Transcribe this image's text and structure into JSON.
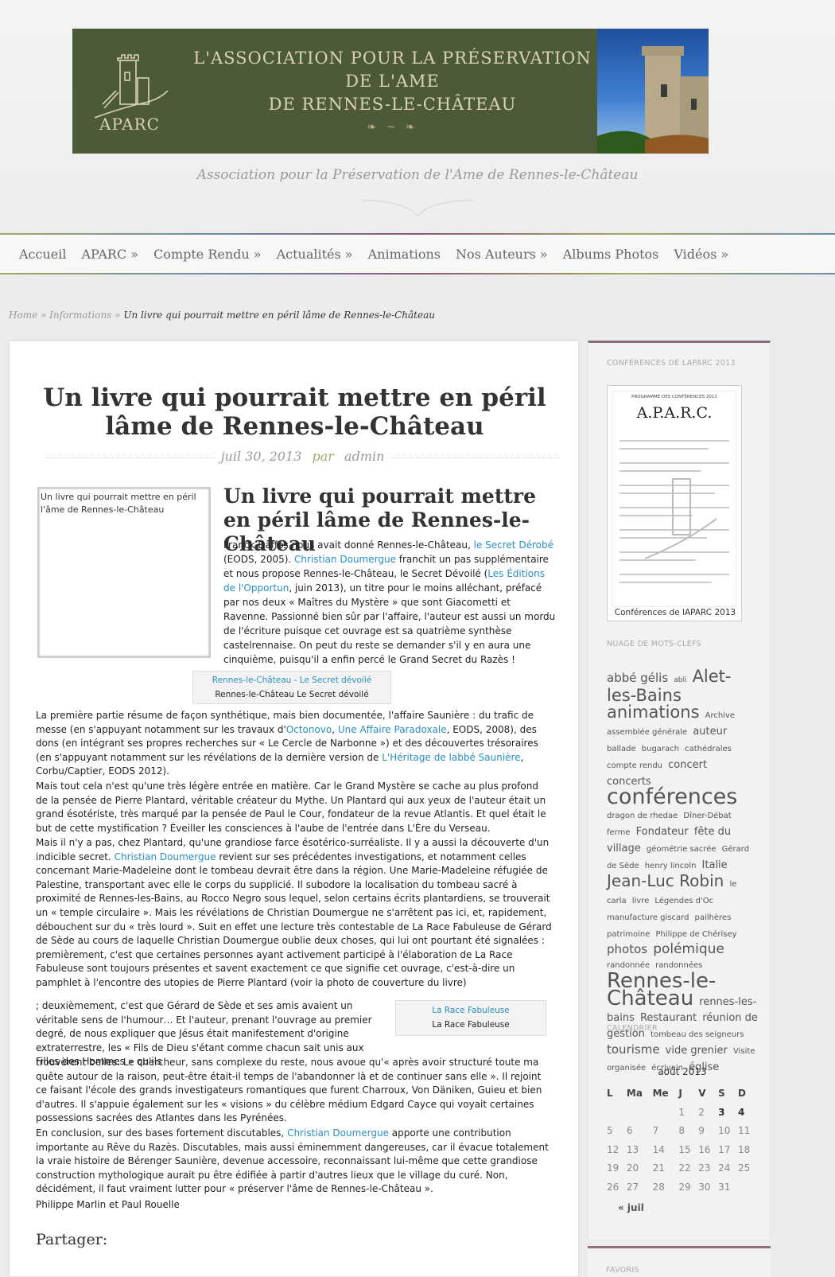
{
  "header": {
    "banner_lines": [
      "L'ASSOCIATION POUR LA PRÉSERVATION",
      "DE L'AME",
      "DE RENNES-LE-CHÂTEAU"
    ],
    "logo_text": "APARC",
    "tagline": "Association pour la Préservation de l'Ame de Rennes-le-Château"
  },
  "nav": [
    "Accueil",
    "APARC »",
    "Compte Rendu »",
    "Actualités »",
    "Animations",
    "Nos Auteurs »",
    "Albums Photos",
    "Vidéos »"
  ],
  "breadcrumb": {
    "home": "Home",
    "sep1": " » ",
    "informations": "Informations",
    "sep2": " » ",
    "current": "Un livre qui pourrait mettre en péril lâme de Rennes-le-Château"
  },
  "post": {
    "title": "Un livre qui pourrait mettre en péril lâme de Rennes-le-Château",
    "date": "juil 30, 2013",
    "by": "par",
    "author": "admin",
    "image_alt": "Un livre qui pourrait mettre en péril l'âme de Rennes-le-Château",
    "subtitle": "Un livre qui pourrait mettre en péril lâme de Rennes-le-Château",
    "intro": [
      {
        "t": "Franck Daffos nous avait donné Rennes-le-Château, "
      },
      {
        "t": "le Secret Dérobé",
        "l": 1
      },
      {
        "t": " (EODS, 2005). "
      },
      {
        "t": "Christian Doumergue",
        "l": 1
      },
      {
        "t": " franchit un pas supplémentaire et nous propose Rennes-le-Château, le Secret Dévoilé ("
      },
      {
        "t": "Les Éditions de l'Opportun",
        "l": 1
      },
      {
        "t": ", juin 2013), un titre pour le moins alléchant, préfacé par nos deux « Maîtres du Mystère » que sont Giacometti et Ravenne. Passionné bien sûr par l'affaire, l'auteur est aussi un mordu de l'écriture puisque cet ouvrage est sa quatrième synthèse castelrennaise. On peut du reste se demander s'il y en aura une cinquième, puisqu'il a enfin percé le Grand Secret du Razès !"
      }
    ],
    "caption1_link": "Rennes-le-Château - Le Secret dévoilé",
    "caption1_text": "Rennes-le-Château Le Secret dévoilé",
    "p1": [
      {
        "t": "La première partie résume de façon synthétique, mais bien documentée, l'affaire Saunière : du trafic de messe (en s'appuyant notamment sur les travaux d'"
      },
      {
        "t": "Octonovo",
        "l": 1
      },
      {
        "t": ", "
      },
      {
        "t": "Une Affaire Paradoxale",
        "l": 1
      },
      {
        "t": ", EODS, 2008), des dons (en intégrant ses propres recherches sur « Le Cercle de Narbonne ») et des découvertes trésoraires (en s'appuyant notamment sur les révélations de la dernière version de "
      },
      {
        "t": "L'Héritage de labbé Saunière",
        "l": 1
      },
      {
        "t": ", Corbu/Captier, EODS 2012)."
      }
    ],
    "p2": [
      {
        "t": "Mais tout cela n'est qu'une très légère entrée en matière. Car le Grand Mystère se cache au plus profond de la pensée de Pierre Plantard, véritable créateur du Mythe. Un Plantard qui aux yeux de l'auteur était un grand ésotériste, très marqué par la pensée de Paul le Cour, fondateur de la revue Atlantis. Et quel était le but de cette mystification ? Éveiller les consciences à l'aube de l'entrée dans L'Ère du Verseau."
      }
    ],
    "p3": [
      {
        "t": "Mais il n'y a pas, chez Plantard, qu'une grandiose farce ésotérico-surréaliste. Il y a aussi la découverte d'un indicible secret. "
      },
      {
        "t": "Christian Doumergue",
        "l": 1
      },
      {
        "t": " revient sur ses précédentes investigations, et notamment celles concernant Marie-Madeleine dont le tombeau devrait être dans la région. Une Marie-Madeleine réfugiée de Palestine, transportant avec elle le corps du supplicié. Il subodore la localisation du tombeau sacré à proximité de Rennes-les-Bains, au Rocco Negro sous lequel, selon certains écrits plantardiens, se trouverait un « temple circulaire ». Mais les révélations de Christian Doumergue ne s'arrêtent pas ici, et, rapidement, débouchent sur du « très lourd ». Suit en effet une lecture très contestable de La Race Fabuleuse de Gérard de Sède au cours de laquelle Christian Doumergue oublie deux choses, qui lui ont pourtant été signalées : premièrement, c'est que certaines personnes ayant activement participé à l'élaboration de La Race Fabuleuse sont toujours présentes et savent exactement ce que signifie cet ouvrage, c'est-à-dire un pamphlet à l'encontre des utopies de Pierre Plantard (voir la photo de couverture du livre)"
      }
    ],
    "caption2_link": "La Race Fabuleuse",
    "caption2_text": "La Race Fabuleuse",
    "p4a": [
      {
        "t": "; deuxièmement, c'est que Gérard de Sède et ses amis avaient un véritable sens de l'humour… Et l'auteur, prenant l'ouvrage au premier degré, de nous expliquer que Jésus était manifestement d'origine extraterrestre, les « Fils de Dieu s'étant comme chacun sait unis aux Filles des Hommes » qu'ils"
      }
    ],
    "p4b": [
      {
        "t": "trouvèrent belles. Le chercheur, sans complexe du reste, nous avoue qu'« après avoir structuré toute ma quête autour de la raison, peut-être était-il temps de l'abandonner là et de continuer sans elle ». Il rejoint ce faisant l'école des grands investigateurs romantiques que furent Charroux, Von Däniken, Guieu et bien d'autres. Il s'appuie également sur les « visions » du célèbre médium Edgard Cayce qui voyait certaines possessions sacrées des Atlantes dans les Pyrénées."
      }
    ],
    "p5": [
      {
        "t": "En conclusion, sur des bases fortement discutables, "
      },
      {
        "t": "Christian Doumergue",
        "l": 1
      },
      {
        "t": " apporte une contribution importante au Rêve du Razès. Discutables, mais aussi éminemment dangereuses, car il évacue totalement la vraie histoire de Bérenger Saunière, devenue accessoire, reconnaissant lui-même que cette grandiose construction mythologique aurait pu être édifiée à partir d'autres lieux que le village du curé. Non, décidément, il faut vraiment lutter pour « préserver l'âme de Rennes-le-Château »."
      }
    ],
    "signature": "Philippe Marlin et Paul Rouelle",
    "share": "Partager:"
  },
  "sidebar": {
    "conf_title": "CONFÉRENCES DE LAPARC 2013",
    "poster_title": "A.P.A.R.C.",
    "poster_head": "PROGRAMME DES CONFÉRENCES 2013",
    "poster_caption": "Conférences de lAPARC 2013",
    "tags_title": "NUAGE DE MOTS-CLEFS",
    "tags": [
      {
        "t": "abbé gélis",
        "s": 15
      },
      {
        "t": "abli",
        "s": 9
      },
      {
        "t": "Alet-les-Bains",
        "s": 21
      },
      {
        "t": "animations",
        "s": 21
      },
      {
        "t": "Archive",
        "s": 10
      },
      {
        "t": "assemblée générale",
        "s": 10
      },
      {
        "t": "auteur",
        "s": 13
      },
      {
        "t": "ballade",
        "s": 10
      },
      {
        "t": "bugarach",
        "s": 10
      },
      {
        "t": "cathédrales",
        "s": 10
      },
      {
        "t": "compte rendu",
        "s": 10
      },
      {
        "t": "concert",
        "s": 13
      },
      {
        "t": "concerts",
        "s": 13
      },
      {
        "t": "conférences",
        "s": 27
      },
      {
        "t": "dragon de rhedae",
        "s": 10
      },
      {
        "t": "Dîner-Débat",
        "s": 10
      },
      {
        "t": "ferme",
        "s": 10
      },
      {
        "t": "Fondateur",
        "s": 13
      },
      {
        "t": "fête du village",
        "s": 13
      },
      {
        "t": "géométrie sacrée",
        "s": 10
      },
      {
        "t": "Gérard de Sède",
        "s": 10
      },
      {
        "t": "henry lincoln",
        "s": 10
      },
      {
        "t": "Italie",
        "s": 13
      },
      {
        "t": "Jean-Luc Robin",
        "s": 20
      },
      {
        "t": "le carla",
        "s": 10
      },
      {
        "t": "livre",
        "s": 10
      },
      {
        "t": "Légendes d'Oc",
        "s": 10
      },
      {
        "t": "manufacture giscard",
        "s": 10
      },
      {
        "t": "pailhères",
        "s": 10
      },
      {
        "t": "patrimoine",
        "s": 10
      },
      {
        "t": "Philippe de Chérisey",
        "s": 10
      },
      {
        "t": "photos",
        "s": 15
      },
      {
        "t": "polémique",
        "s": 17
      },
      {
        "t": "randonnée",
        "s": 10
      },
      {
        "t": "randonnées",
        "s": 10
      },
      {
        "t": "Rennes-le-Château",
        "s": 26
      },
      {
        "t": "rennes-les-bains",
        "s": 13
      },
      {
        "t": "Restaurant",
        "s": 13
      },
      {
        "t": "réunion de gestion",
        "s": 13
      },
      {
        "t": "tombeau des seigneurs",
        "s": 10
      },
      {
        "t": "tourisme",
        "s": 15
      },
      {
        "t": "vide grenier",
        "s": 13
      },
      {
        "t": "Visite organisée",
        "s": 10
      },
      {
        "t": "écrivain",
        "s": 10
      },
      {
        "t": "église",
        "s": 13
      }
    ],
    "cal_section": "CALENDRIER",
    "cal_title": "août 2013",
    "cal_days": [
      "L",
      "Ma",
      "Me",
      "J",
      "V",
      "S",
      "D"
    ],
    "cal_weeks": [
      [
        "",
        "",
        "",
        "1",
        "2",
        "3",
        "4"
      ],
      [
        "5",
        "6",
        "7",
        "8",
        "9",
        "10",
        "11"
      ],
      [
        "12",
        "13",
        "14",
        "15",
        "16",
        "17",
        "18"
      ],
      [
        "19",
        "20",
        "21",
        "22",
        "23",
        "24",
        "25"
      ],
      [
        "26",
        "27",
        "28",
        "29",
        "30",
        "31",
        ""
      ]
    ],
    "cal_linked": [
      "3",
      "4"
    ],
    "cal_prev": "« juil",
    "favoris": "FAVORIS"
  },
  "colors": {
    "banner": "#4c5a3a",
    "link": "#2a8fc2",
    "author": "#a2a864",
    "sidebar_border": "#8b6f7e"
  }
}
